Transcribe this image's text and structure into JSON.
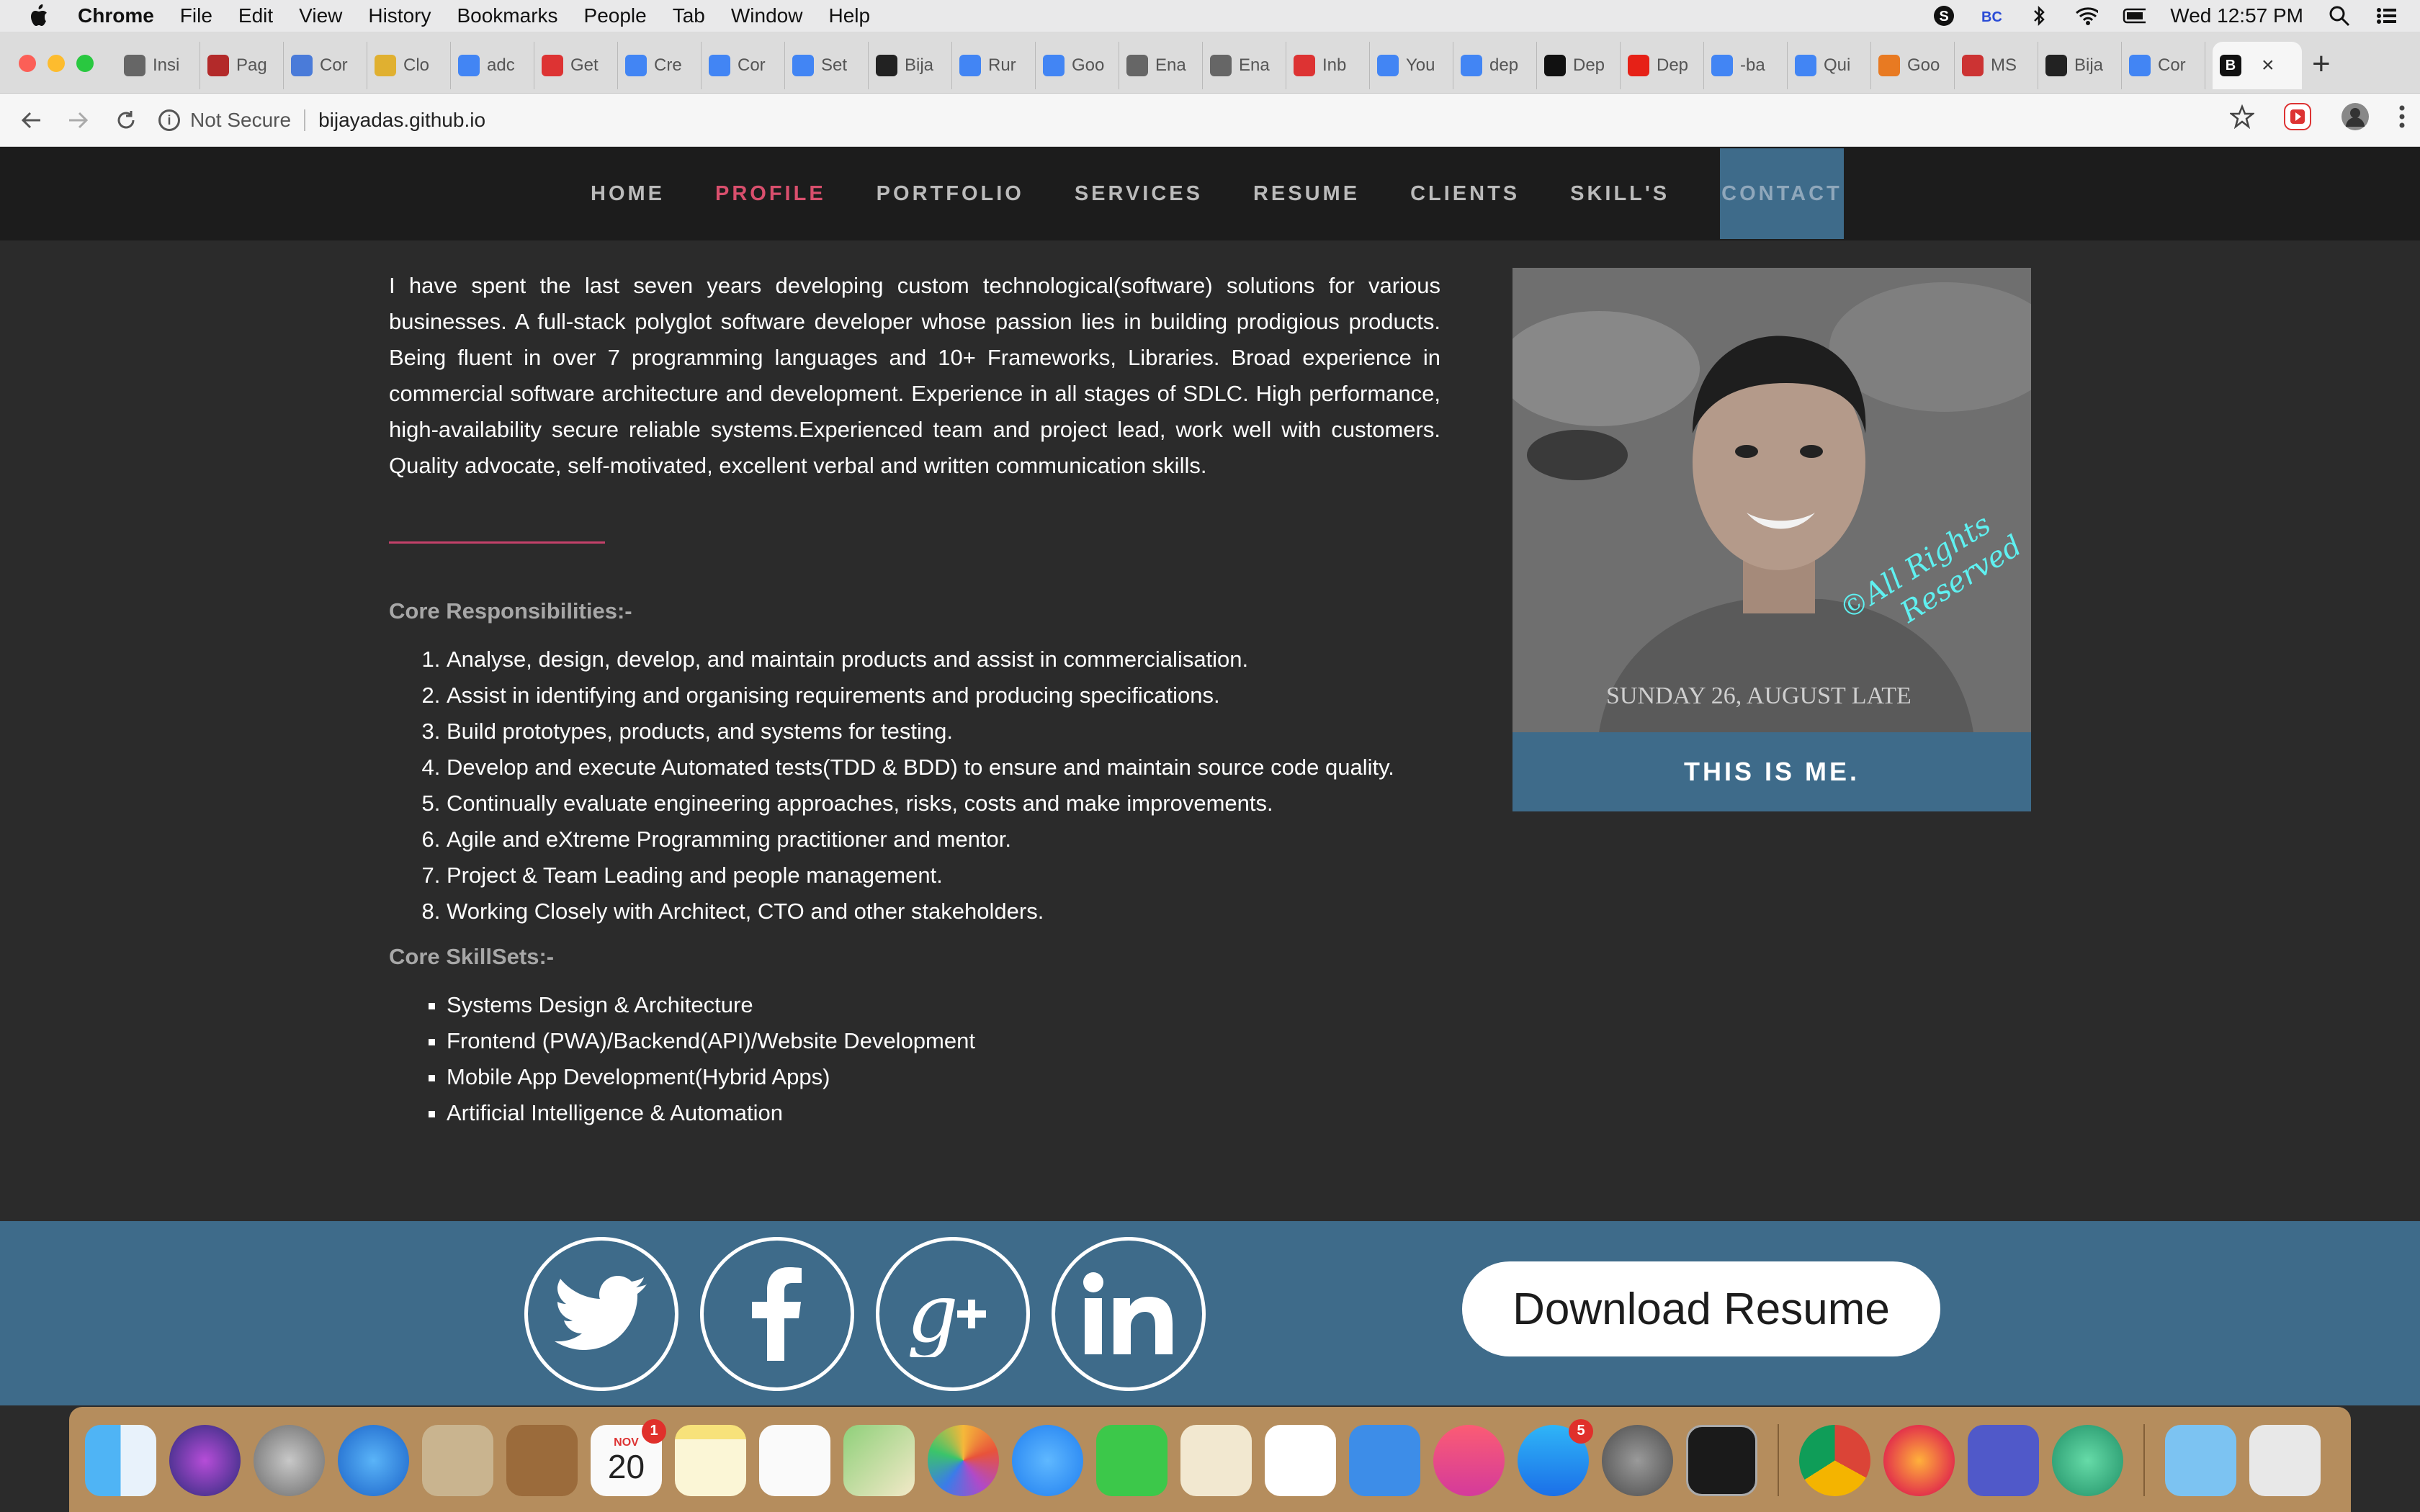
{
  "menubar": {
    "app": "Chrome",
    "items": [
      "File",
      "Edit",
      "View",
      "History",
      "Bookmarks",
      "People",
      "Tab",
      "Window",
      "Help"
    ],
    "clock": "Wed 12:57 PM"
  },
  "tabs": [
    {
      "label": "Insi",
      "icon": "globe-icon",
      "color": "#666666"
    },
    {
      "label": "Pag",
      "icon": "pr-icon",
      "color": "#b32a2a"
    },
    {
      "label": "Cor",
      "icon": "cpu-icon",
      "color": "#4a7bd9"
    },
    {
      "label": "Clo",
      "icon": "chrome-icon",
      "color": "#e0b030"
    },
    {
      "label": "adc",
      "icon": "google-icon",
      "color": "#4285f4"
    },
    {
      "label": "Get",
      "icon": "gift-icon",
      "color": "#d33"
    },
    {
      "label": "Cre",
      "icon": "google-icon",
      "color": "#4285f4"
    },
    {
      "label": "Cor",
      "icon": "cloud-icon",
      "color": "#4285f4"
    },
    {
      "label": "Set",
      "icon": "cloud-icon",
      "color": "#4285f4"
    },
    {
      "label": "Bija",
      "icon": "github-icon",
      "color": "#222222"
    },
    {
      "label": "Rur",
      "icon": "cloud-icon",
      "color": "#4285f4"
    },
    {
      "label": "Goo",
      "icon": "cloud-icon",
      "color": "#4285f4"
    },
    {
      "label": "Ena",
      "icon": "gear-icon",
      "color": "#666666"
    },
    {
      "label": "Ena",
      "icon": "gear-icon",
      "color": "#666666"
    },
    {
      "label": "Inb",
      "icon": "gmail-icon",
      "color": "#d33"
    },
    {
      "label": "You",
      "icon": "cloud-icon",
      "color": "#4285f4"
    },
    {
      "label": "dep",
      "icon": "google-icon",
      "color": "#4285f4"
    },
    {
      "label": "Dep",
      "icon": "medium-icon",
      "color": "#111111"
    },
    {
      "label": "Dep",
      "icon": "youtube-icon",
      "color": "#e62117"
    },
    {
      "label": "-ba",
      "icon": "google-icon",
      "color": "#4285f4"
    },
    {
      "label": "Qui",
      "icon": "cloud-icon",
      "color": "#4285f4"
    },
    {
      "label": "Goo",
      "icon": "stack-icon",
      "color": "#e87a22"
    },
    {
      "label": "MS",
      "icon": "ms-icon",
      "color": "#c33"
    },
    {
      "label": "Bija",
      "icon": "github-icon",
      "color": "#222222"
    },
    {
      "label": "Cor",
      "icon": "cloud-icon",
      "color": "#4285f4"
    }
  ],
  "active_tab": {
    "letter": "B",
    "close": "×"
  },
  "new_tab": "+",
  "toolbar": {
    "not_secure": "Not Secure",
    "url": "bijayadas.github.io"
  },
  "site_nav": {
    "items": [
      "HOME",
      "PROFILE",
      "PORTFOLIO",
      "SERVICES",
      "RESUME",
      "CLIENTS",
      "SKILL'S",
      "CONTACT"
    ],
    "active": "PROFILE",
    "hovered": "CONTACT"
  },
  "profile": {
    "intro": "I have spent the last seven years developing custom technological(software) solutions for various businesses. A full-stack polyglot software developer whose passion lies in building prodigious products. Being fluent in over 7 programming languages and 10+ Frameworks, Libraries. Broad experience in commercial software architecture and development. Experience in all stages of SDLC. High performance, high-availability secure reliable systems.Experienced team and project lead, work well with customers. Quality advocate, self-motivated, excellent verbal and written communication skills.",
    "responsibilities_title": "Core Responsibilities:-",
    "responsibilities": [
      "Analyse, design, develop, and maintain products and assist in commercialisation.",
      "Assist in identifying and organising requirements and producing specifications.",
      "Build prototypes, products, and systems for testing.",
      "Develop and execute Automated tests(TDD & BDD) to ensure and maintain source code quality.",
      "Continually evaluate engineering approaches, risks, costs and make improvements.",
      "Agile and eXtreme Programming practitioner and mentor.",
      "Project & Team Leading and people management.",
      "Working Closely with Architect, CTO and other stakeholders."
    ],
    "skills_title": "Core SkillSets:-",
    "skills": [
      "Systems Design & Architecture",
      "Frontend (PWA)/Backend(API)/Website Development",
      "Mobile App Development(Hybrid Apps)",
      "Artificial Intelligence & Automation"
    ],
    "photo_caption": "THIS IS ME.",
    "photo_watermark": "©All Rights Reserved",
    "photo_shirt_text": "SUNDAY 26, AUGUST LATE"
  },
  "footer": {
    "social": [
      "twitter-icon",
      "facebook-icon",
      "google-plus-icon",
      "linkedin-icon"
    ],
    "download_label": "Download Resume"
  },
  "dock": {
    "calendar_month": "NOV",
    "calendar_day": "20",
    "calendar_badge": "1",
    "appstore_badge": "5"
  },
  "colors": {
    "accent_blue": "#3e6b8a",
    "accent_pink": "#d94f6d",
    "page_bg": "#2b2b2b",
    "nav_bg": "#1c1c1c"
  }
}
